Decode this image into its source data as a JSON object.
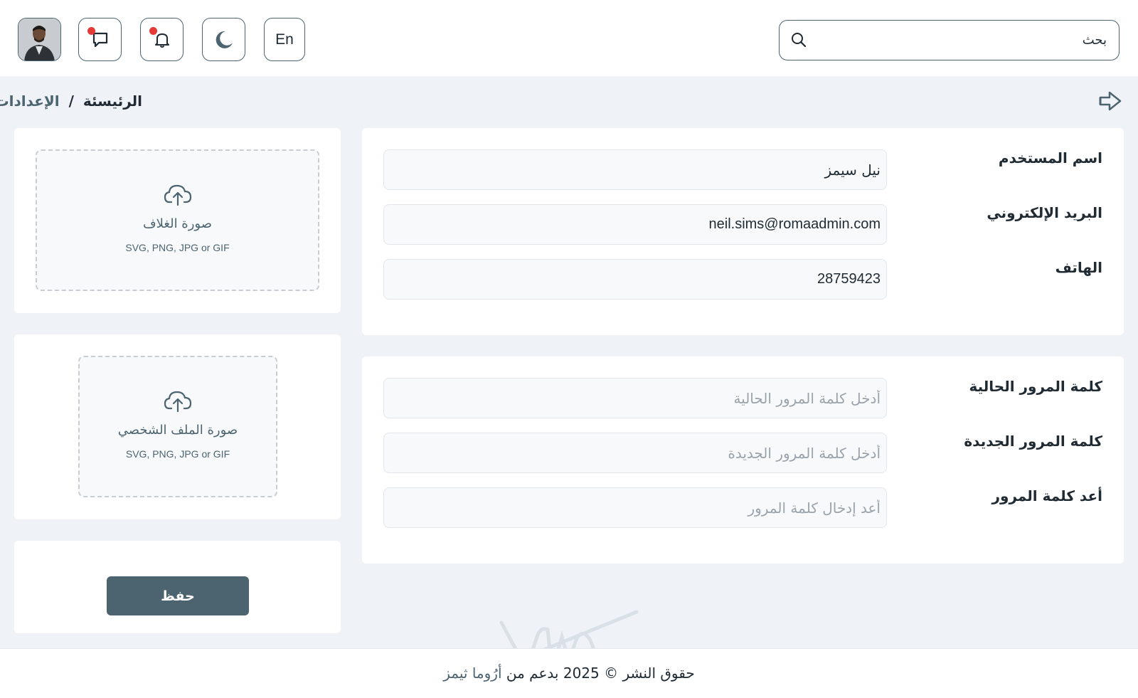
{
  "header": {
    "language_button": "En",
    "search": {
      "placeholder": "بحث"
    },
    "icons": [
      "avatar",
      "message-icon",
      "bell-icon",
      "moon-icon",
      "search-icon"
    ],
    "notification_dot_color": "#e53935"
  },
  "breadcrumb": {
    "home": "الرئيسئة",
    "separator": "/",
    "current": "الإعدادات"
  },
  "uploads": {
    "cover": {
      "title": "صورة الغلاف",
      "formats": "SVG, PNG, JPG or GIF"
    },
    "profile": {
      "title": "صورة الملف الشخصي",
      "formats": "SVG, PNG, JPG or GIF"
    }
  },
  "save_button": "حفظ",
  "profile_form": {
    "username": {
      "label": "اسم المستخدم",
      "value": "نيل سيمز"
    },
    "email": {
      "label": "البريد الإلكتروني",
      "value": "neil.sims@romaadmin.com"
    },
    "phone": {
      "label": "الهاتف",
      "value": "28759423"
    }
  },
  "password_form": {
    "current": {
      "label": "كلمة المرور الحالية",
      "placeholder": "أدخل كلمة المرور الحالية"
    },
    "new": {
      "label": "كلمة المرور الجديدة",
      "placeholder": "أدخل كلمة المرور الجديدة"
    },
    "confirm": {
      "label": "أعد كلمة المرور",
      "placeholder": "أعد إدخال كلمة المرور"
    }
  },
  "footer": {
    "copyright": "حقوق النشر © 2025 بدعم من",
    "brand": "أرُوما ثيمز"
  },
  "colors": {
    "accent": "#4b6470",
    "background": "#eff3f7",
    "card": "#ffffff"
  }
}
